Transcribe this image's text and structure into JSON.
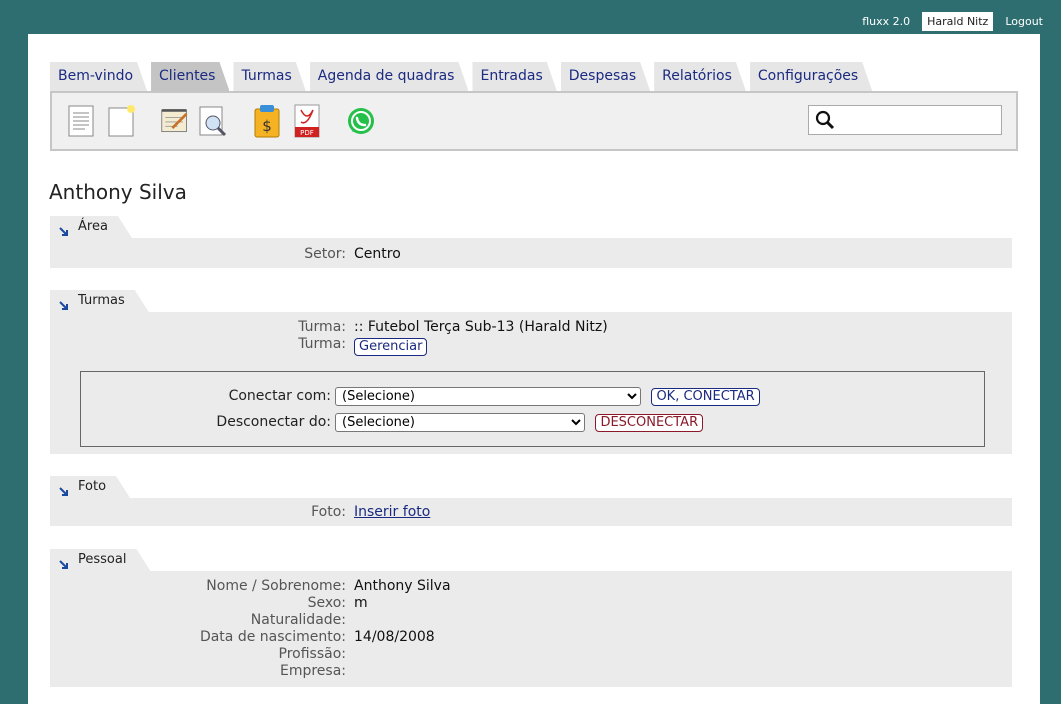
{
  "topbar": {
    "version": "fluxx 2.0",
    "user": "Harald Nitz",
    "logout": "Logout"
  },
  "tabs": [
    {
      "label": "Bem-vindo",
      "active": false
    },
    {
      "label": "Clientes",
      "active": true
    },
    {
      "label": "Turmas",
      "active": false
    },
    {
      "label": "Agenda de quadras",
      "active": false
    },
    {
      "label": "Entradas",
      "active": false
    },
    {
      "label": "Despesas",
      "active": false
    },
    {
      "label": "Relatórios",
      "active": false
    },
    {
      "label": "Configurações",
      "active": false
    }
  ],
  "toolbar": {
    "icons": [
      "list-document-icon",
      "new-document-icon",
      "edit-notepad-icon",
      "search-document-icon",
      "payment-clipboard-icon",
      "pdf-icon",
      "whatsapp-icon"
    ],
    "search_placeholder": ""
  },
  "page_title": "Anthony Silva",
  "sections": {
    "area": {
      "title": "Área",
      "rows": [
        {
          "label": "Setor:",
          "value": "Centro"
        }
      ]
    },
    "turmas": {
      "title": "Turmas",
      "turma_label": "Turma:",
      "turma_value": ":: Futebol Terça Sub-13 (Harald Nitz)",
      "turma2_label": "Turma:",
      "manage_button": "Gerenciar",
      "connect_label": "Conectar com:",
      "connect_select": "(Selecione)",
      "connect_button": "OK, CONECTAR",
      "disconnect_label": "Desconectar do:",
      "disconnect_select": "(Selecione)",
      "disconnect_button": "DESCONECTAR"
    },
    "foto": {
      "title": "Foto",
      "label": "Foto:",
      "link": "Inserir foto"
    },
    "pessoal": {
      "title": "Pessoal",
      "rows": [
        {
          "label": "Nome / Sobrenome:",
          "value": "Anthony Silva"
        },
        {
          "label": "Sexo:",
          "value": "m"
        },
        {
          "label": "Naturalidade:",
          "value": ""
        },
        {
          "label": "Data de nascimento:",
          "value": "14/08/2008"
        },
        {
          "label": "Profissão:",
          "value": ""
        },
        {
          "label": "Empresa:",
          "value": ""
        }
      ]
    }
  },
  "colors": {
    "background": "#2e6e71",
    "link": "#1a2a80",
    "danger": "#8a1a2a",
    "section_bg": "#ebebeb"
  }
}
